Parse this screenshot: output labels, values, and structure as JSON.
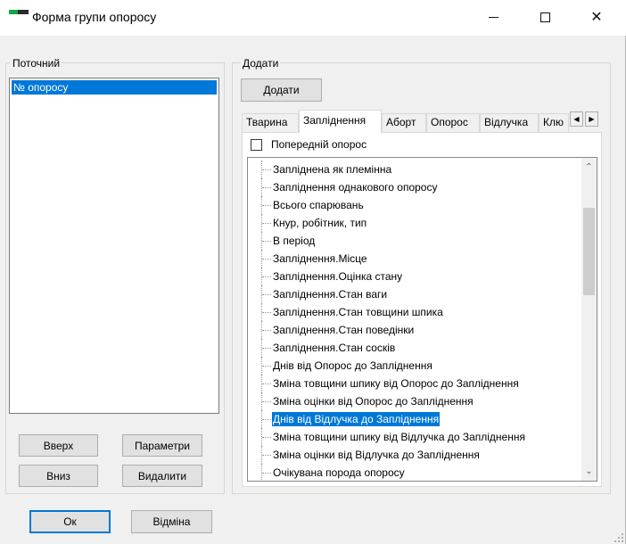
{
  "window": {
    "title": "Форма групи опоросу",
    "controls": {
      "minimize": "minimize",
      "maximize": "maximize",
      "close": "✕"
    }
  },
  "current_group": {
    "label": "Поточний",
    "items": [
      "№ опоросу"
    ],
    "buttons": {
      "up": "Вверх",
      "params": "Параметри",
      "down": "Вниз",
      "delete": "Видалити"
    }
  },
  "add_group": {
    "label": "Додати",
    "add_button": "Додати",
    "tabs": [
      "Тварина",
      "Запліднення",
      "Аборт",
      "Опорос",
      "Відлучка",
      "Клю"
    ],
    "active_tab": "Запліднення",
    "checkbox_label": "Попередній опорос",
    "tree_items": [
      "Запліднена як племінна",
      "Запліднення однакового опоросу",
      "Всього спарювань",
      "Кнур, робітник, тип",
      "В період",
      "Запліднення.Місце",
      "Запліднення.Оцінка стану",
      "Запліднення.Стан ваги",
      "Запліднення.Стан товщини шпика",
      "Запліднення.Стан поведінки",
      "Запліднення.Стан сосків",
      "Днів від Опорос  до Запліднення",
      "Зміна товщини шпику від Опорос до Запліднення",
      "Зміна оцінки від Опорос до Запліднення",
      "Днів від Відлучка  до Запліднення",
      "Зміна товщини шпику від Відлучка до Запліднення",
      "Зміна оцінки від Відлучка до Запліднення",
      "Очікувана порода опоросу"
    ],
    "selected_tree_item": "Днів від Відлучка  до Запліднення"
  },
  "footer": {
    "ok": "Ок",
    "cancel": "Відміна"
  },
  "colors": {
    "selection": "#0078d7",
    "default_button_border": "#0078d7",
    "icon_green": "#12a64a"
  }
}
